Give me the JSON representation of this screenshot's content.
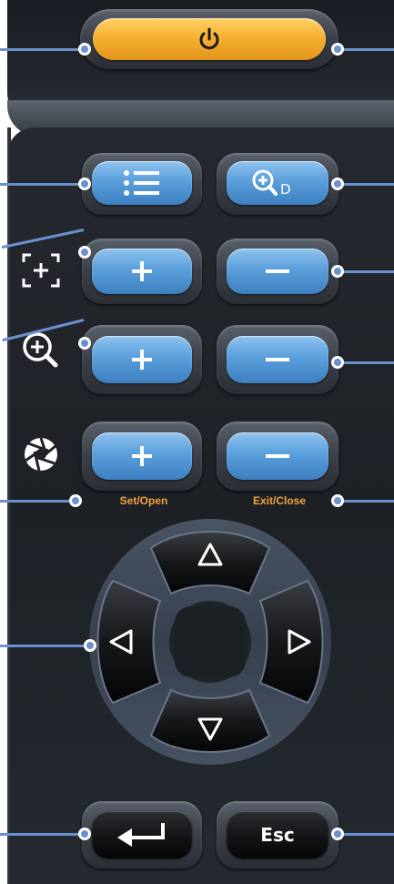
{
  "panel": {
    "set_open_label": "Set/Open",
    "exit_close_label": "Exit/Close",
    "esc_label": "Esc"
  },
  "colors": {
    "accent_orange": "#f2a23a",
    "button_blue": "#5b9fdc",
    "callout_line": "#6b8fcf",
    "power_button": "#f6b132"
  },
  "icons": {
    "power": "power-icon",
    "menu": "menu-list-icon",
    "digital_zoom": "digital-zoom-icon",
    "focus": "focus-bracket-icon",
    "zoom": "zoom-icon",
    "iris": "aperture-icon",
    "arrows": [
      "arrow-up-icon",
      "arrow-down-icon",
      "arrow-left-icon",
      "arrow-right-icon"
    ],
    "enter": "enter-icon"
  }
}
